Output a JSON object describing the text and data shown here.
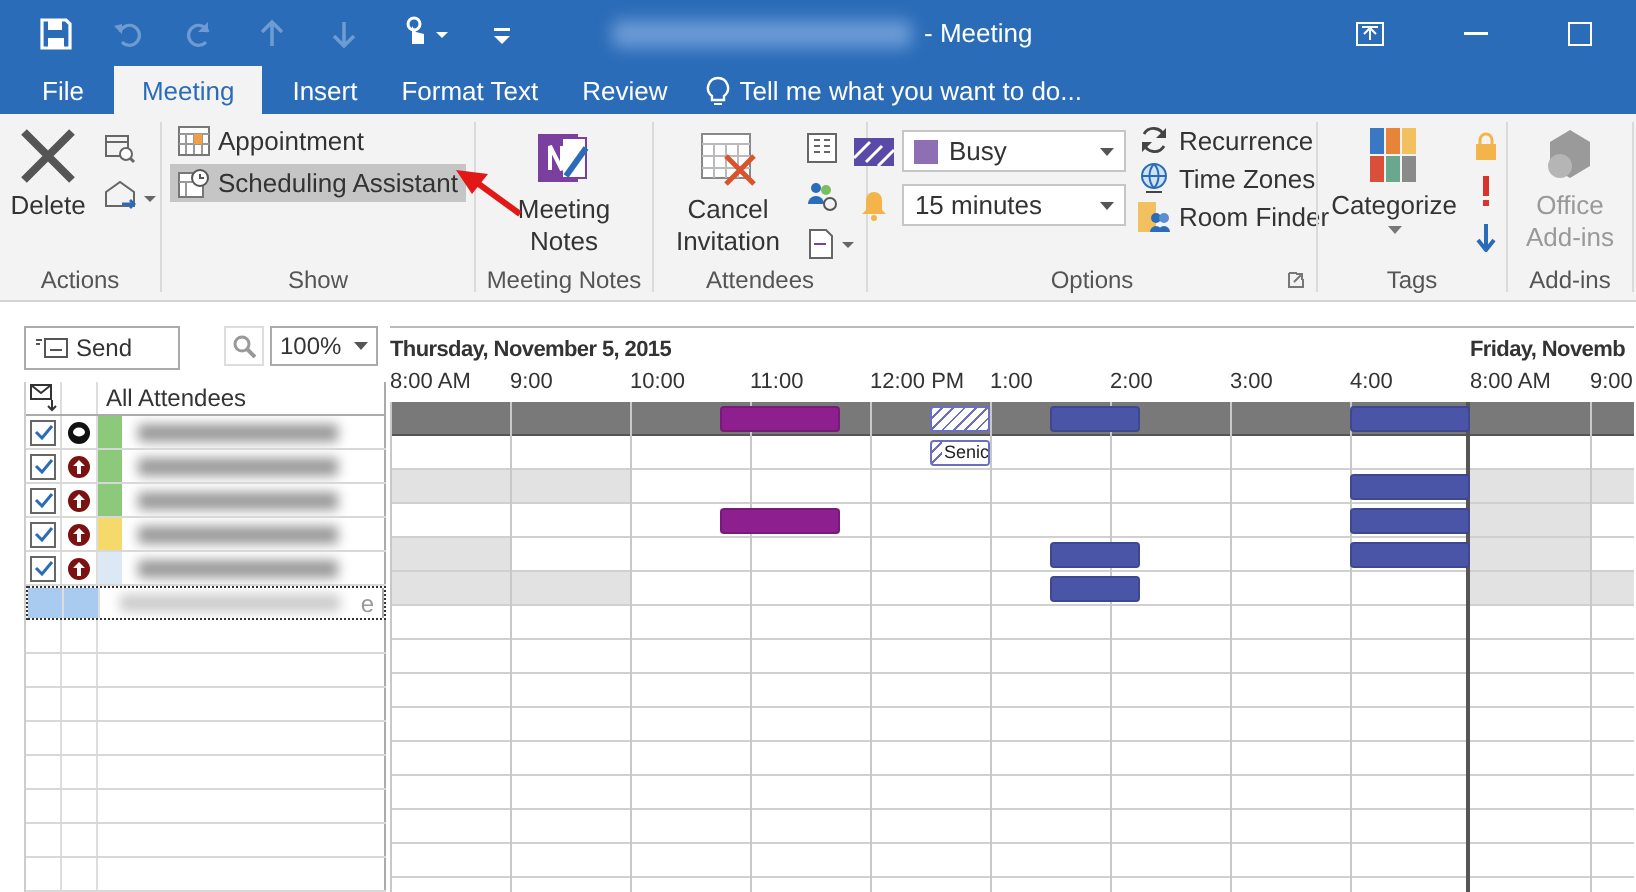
{
  "window": {
    "title": "- Meeting"
  },
  "tabs": [
    {
      "label": "File",
      "selected": false
    },
    {
      "label": "Meeting",
      "selected": true
    },
    {
      "label": "Insert",
      "selected": false
    },
    {
      "label": "Format Text",
      "selected": false
    },
    {
      "label": "Review",
      "selected": false
    }
  ],
  "tell_me": {
    "placeholder": "Tell me what you want to do..."
  },
  "ribbon": {
    "actions": {
      "label": "Actions",
      "delete": "Delete"
    },
    "show": {
      "label": "Show",
      "items": [
        {
          "label": "Appointment",
          "selected": false
        },
        {
          "label": "Scheduling Assistant",
          "selected": true
        }
      ]
    },
    "meeting_notes": {
      "label": "Meeting Notes",
      "button": "Meeting Notes"
    },
    "attendees": {
      "label": "Attendees",
      "button": "Cancel Invitation"
    },
    "options": {
      "label": "Options",
      "show_as": "Busy",
      "reminder": "15 minutes",
      "links": [
        "Recurrence",
        "Time Zones",
        "Room Finder"
      ]
    },
    "tags": {
      "label": "Tags",
      "button": "Categorize"
    },
    "addins": {
      "label": "Add-ins",
      "button": "Office Add-ins",
      "disabled": true
    }
  },
  "toolbar": {
    "send": "Send",
    "zoom": "100%"
  },
  "days": [
    {
      "title": "Thursday, November 5, 2015",
      "hours": [
        "8:00 AM",
        "9:00",
        "10:00",
        "11:00",
        "12:00 PM",
        "1:00",
        "2:00",
        "3:00",
        "4:00"
      ]
    },
    {
      "title": "Friday, Novemb",
      "hours": [
        "8:00 AM",
        "9:00"
      ]
    }
  ],
  "all_attendees": {
    "label": "All Attendees",
    "slots": [
      {
        "kind": "free"
      },
      {
        "kind": "free"
      },
      {
        "kind": "free"
      },
      {
        "kind": "free"
      },
      {
        "kind": "free"
      },
      {
        "kind": "free"
      },
      {
        "kind": "free"
      },
      {
        "kind": "free"
      },
      {
        "kind": "free"
      },
      {
        "kind": "free"
      },
      {
        "kind": "free"
      },
      {
        "kind": "away"
      },
      {
        "kind": "away"
      },
      {
        "kind": "away"
      },
      {
        "kind": "away"
      },
      {
        "kind": "free"
      },
      {
        "kind": "free"
      },
      {
        "kind": "free"
      },
      {
        "kind": "tentative"
      },
      {
        "kind": "tentative"
      },
      {
        "kind": "free"
      },
      {
        "kind": "free"
      },
      {
        "kind": "busy"
      },
      {
        "kind": "busy"
      },
      {
        "kind": "busy"
      },
      {
        "kind": "free"
      },
      {
        "kind": "free"
      },
      {
        "kind": "free"
      },
      {
        "kind": "free"
      },
      {
        "kind": "free"
      },
      {
        "kind": "free"
      },
      {
        "kind": "free"
      },
      {
        "kind": "busy"
      },
      {
        "kind": "busy"
      },
      {
        "kind": "busy"
      },
      {
        "kind": "busy"
      },
      {
        "kind": "free"
      },
      {
        "kind": "free"
      },
      {
        "kind": "free"
      },
      {
        "kind": "free"
      },
      {
        "kind": "free"
      }
    ]
  },
  "attendees": [
    {
      "kind": "organizer",
      "checked": true,
      "color": "#8cc97a",
      "slots": [
        {
          "kind": "free"
        },
        {
          "kind": "free"
        },
        {
          "kind": "free"
        },
        {
          "kind": "free"
        },
        {
          "kind": "free"
        },
        {
          "kind": "free"
        },
        {
          "kind": "free"
        },
        {
          "kind": "free"
        },
        {
          "kind": "free"
        },
        {
          "kind": "free"
        },
        {
          "kind": "free"
        },
        {
          "kind": "free"
        },
        {
          "kind": "free"
        },
        {
          "kind": "free"
        },
        {
          "kind": "free"
        },
        {
          "kind": "free"
        },
        {
          "kind": "free"
        },
        {
          "kind": "free"
        },
        {
          "kind": "tentative",
          "label": "Senic"
        },
        {
          "kind": "tentative"
        },
        {
          "kind": "free"
        },
        {
          "kind": "free"
        },
        {
          "kind": "free"
        },
        {
          "kind": "free"
        },
        {
          "kind": "free"
        },
        {
          "kind": "free"
        },
        {
          "kind": "free"
        },
        {
          "kind": "free"
        },
        {
          "kind": "free"
        },
        {
          "kind": "free"
        },
        {
          "kind": "free"
        },
        {
          "kind": "free"
        },
        {
          "kind": "free"
        },
        {
          "kind": "free"
        },
        {
          "kind": "free"
        },
        {
          "kind": "free"
        },
        {
          "kind": "free"
        },
        {
          "kind": "free"
        },
        {
          "kind": "free"
        },
        {
          "kind": "free"
        },
        {
          "kind": "free"
        }
      ]
    },
    {
      "kind": "required",
      "checked": true,
      "color": "#8cc97a",
      "slots": [
        {
          "kind": "shaded"
        },
        {
          "kind": "shaded"
        },
        {
          "kind": "shaded"
        },
        {
          "kind": "shaded"
        },
        {
          "kind": "shaded"
        },
        {
          "kind": "shaded"
        },
        {
          "kind": "shaded"
        },
        {
          "kind": "shaded"
        },
        {
          "kind": "free"
        },
        {
          "kind": "free"
        },
        {
          "kind": "free"
        },
        {
          "kind": "free"
        },
        {
          "kind": "free"
        },
        {
          "kind": "free"
        },
        {
          "kind": "free"
        },
        {
          "kind": "free"
        },
        {
          "kind": "free"
        },
        {
          "kind": "free"
        },
        {
          "kind": "free"
        },
        {
          "kind": "free"
        },
        {
          "kind": "free"
        },
        {
          "kind": "free"
        },
        {
          "kind": "free"
        },
        {
          "kind": "free"
        },
        {
          "kind": "free"
        },
        {
          "kind": "free"
        },
        {
          "kind": "free"
        },
        {
          "kind": "free"
        },
        {
          "kind": "free"
        },
        {
          "kind": "free"
        },
        {
          "kind": "free"
        },
        {
          "kind": "free"
        },
        {
          "kind": "busy"
        },
        {
          "kind": "busy"
        },
        {
          "kind": "busy"
        },
        {
          "kind": "busy"
        },
        {
          "kind": "shaded"
        },
        {
          "kind": "shaded"
        },
        {
          "kind": "shaded"
        },
        {
          "kind": "shaded"
        },
        {
          "kind": "shaded"
        }
      ]
    },
    {
      "kind": "required",
      "checked": true,
      "color": "#8cc97a",
      "slots": [
        {
          "kind": "free"
        },
        {
          "kind": "free"
        },
        {
          "kind": "free"
        },
        {
          "kind": "free"
        },
        {
          "kind": "free"
        },
        {
          "kind": "free"
        },
        {
          "kind": "free"
        },
        {
          "kind": "free"
        },
        {
          "kind": "free"
        },
        {
          "kind": "free"
        },
        {
          "kind": "free"
        },
        {
          "kind": "away"
        },
        {
          "kind": "away"
        },
        {
          "kind": "away"
        },
        {
          "kind": "away"
        },
        {
          "kind": "free"
        },
        {
          "kind": "free"
        },
        {
          "kind": "free"
        },
        {
          "kind": "free"
        },
        {
          "kind": "free"
        },
        {
          "kind": "free"
        },
        {
          "kind": "free"
        },
        {
          "kind": "free"
        },
        {
          "kind": "free"
        },
        {
          "kind": "free"
        },
        {
          "kind": "free"
        },
        {
          "kind": "free"
        },
        {
          "kind": "free"
        },
        {
          "kind": "free"
        },
        {
          "kind": "free"
        },
        {
          "kind": "free"
        },
        {
          "kind": "free"
        },
        {
          "kind": "busy"
        },
        {
          "kind": "busy"
        },
        {
          "kind": "busy"
        },
        {
          "kind": "busy"
        },
        {
          "kind": "shaded"
        },
        {
          "kind": "shaded"
        },
        {
          "kind": "shaded"
        },
        {
          "kind": "shaded"
        },
        {
          "kind": "free"
        }
      ]
    },
    {
      "kind": "required",
      "checked": true,
      "color": "#f6d96b",
      "slots": [
        {
          "kind": "shaded"
        },
        {
          "kind": "shaded"
        },
        {
          "kind": "shaded"
        },
        {
          "kind": "shaded"
        },
        {
          "kind": "free"
        },
        {
          "kind": "free"
        },
        {
          "kind": "free"
        },
        {
          "kind": "free"
        },
        {
          "kind": "free"
        },
        {
          "kind": "free"
        },
        {
          "kind": "free"
        },
        {
          "kind": "free"
        },
        {
          "kind": "free"
        },
        {
          "kind": "free"
        },
        {
          "kind": "free"
        },
        {
          "kind": "free"
        },
        {
          "kind": "free"
        },
        {
          "kind": "free"
        },
        {
          "kind": "free"
        },
        {
          "kind": "free"
        },
        {
          "kind": "free"
        },
        {
          "kind": "free"
        },
        {
          "kind": "busy"
        },
        {
          "kind": "busy"
        },
        {
          "kind": "busy"
        },
        {
          "kind": "free"
        },
        {
          "kind": "free"
        },
        {
          "kind": "free"
        },
        {
          "kind": "free"
        },
        {
          "kind": "free"
        },
        {
          "kind": "free"
        },
        {
          "kind": "free"
        },
        {
          "kind": "busy"
        },
        {
          "kind": "busy"
        },
        {
          "kind": "busy"
        },
        {
          "kind": "busy"
        },
        {
          "kind": "shaded"
        },
        {
          "kind": "shaded"
        },
        {
          "kind": "shaded"
        },
        {
          "kind": "shaded"
        },
        {
          "kind": "free"
        }
      ]
    },
    {
      "kind": "required",
      "checked": true,
      "color": "#dce8f3",
      "slots": [
        {
          "kind": "shaded"
        },
        {
          "kind": "shaded"
        },
        {
          "kind": "shaded"
        },
        {
          "kind": "shaded"
        },
        {
          "kind": "shaded"
        },
        {
          "kind": "shaded"
        },
        {
          "kind": "shaded"
        },
        {
          "kind": "shaded"
        },
        {
          "kind": "free"
        },
        {
          "kind": "free"
        },
        {
          "kind": "free"
        },
        {
          "kind": "free"
        },
        {
          "kind": "free"
        },
        {
          "kind": "free"
        },
        {
          "kind": "free"
        },
        {
          "kind": "free"
        },
        {
          "kind": "free"
        },
        {
          "kind": "free"
        },
        {
          "kind": "free"
        },
        {
          "kind": "free"
        },
        {
          "kind": "free"
        },
        {
          "kind": "free"
        },
        {
          "kind": "busy"
        },
        {
          "kind": "busy"
        },
        {
          "kind": "busy"
        },
        {
          "kind": "free"
        },
        {
          "kind": "free"
        },
        {
          "kind": "free"
        },
        {
          "kind": "free"
        },
        {
          "kind": "free"
        },
        {
          "kind": "free"
        },
        {
          "kind": "free"
        },
        {
          "kind": "free"
        },
        {
          "kind": "free"
        },
        {
          "kind": "free"
        },
        {
          "kind": "free"
        },
        {
          "kind": "shaded"
        },
        {
          "kind": "shaded"
        },
        {
          "kind": "shaded"
        },
        {
          "kind": "shaded"
        },
        {
          "kind": "shaded"
        }
      ]
    }
  ],
  "new_row": {
    "hint": "e",
    "selected": true
  }
}
